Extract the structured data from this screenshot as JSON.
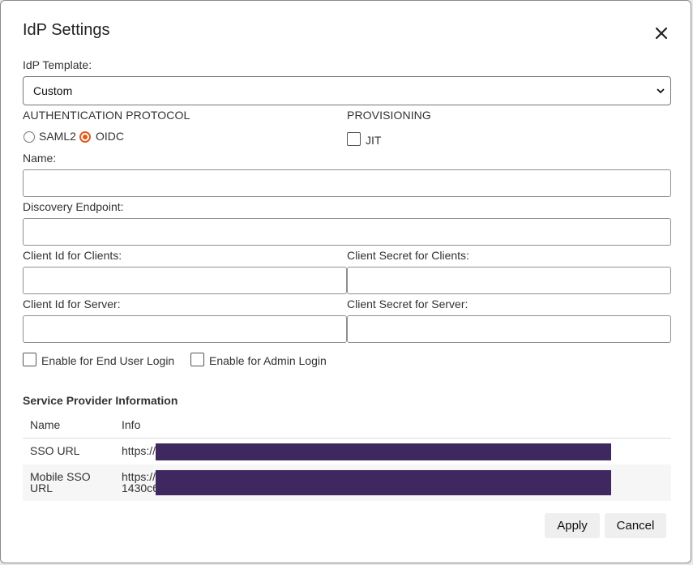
{
  "dialog": {
    "title": "IdP Settings",
    "close_icon": "close-icon"
  },
  "template": {
    "label": "IdP Template:",
    "selected": "Custom",
    "chevron_icon": "chevron-down-icon"
  },
  "auth": {
    "label": "AUTHENTICATION PROTOCOL",
    "options": [
      {
        "label": "SAML2",
        "selected": false
      },
      {
        "label": "OIDC",
        "selected": true
      }
    ],
    "accent_color": "#e05a1c"
  },
  "provisioning": {
    "label": "PROVISIONING",
    "jit_label": "JIT",
    "jit_checked": false
  },
  "fields": {
    "name_label": "Name:",
    "name_value": "",
    "discovery_label": "Discovery Endpoint:",
    "discovery_value": "",
    "client_id_clients_label": "Client Id for Clients:",
    "client_id_clients_value": "",
    "client_secret_clients_label": "Client Secret for Clients:",
    "client_secret_clients_value": "",
    "client_id_server_label": "Client Id for Server:",
    "client_id_server_value": "",
    "client_secret_server_label": "Client Secret for Server:",
    "client_secret_server_value": ""
  },
  "options": {
    "end_user_login_label": "Enable for End User Login",
    "end_user_login_checked": false,
    "admin_login_label": "Enable for Admin Login",
    "admin_login_checked": false
  },
  "sp_info": {
    "title": "Service Provider Information",
    "columns": [
      "Name",
      "Info"
    ],
    "rows": [
      {
        "name": "SSO URL",
        "info": "https://"
      },
      {
        "name_line1": "Mobile SSO",
        "name_line2": "URL",
        "info_line1": "https://",
        "info_line2": "1430c6"
      }
    ],
    "redaction_color": "#3f2860"
  },
  "footer": {
    "apply_label": "Apply",
    "cancel_label": "Cancel"
  }
}
